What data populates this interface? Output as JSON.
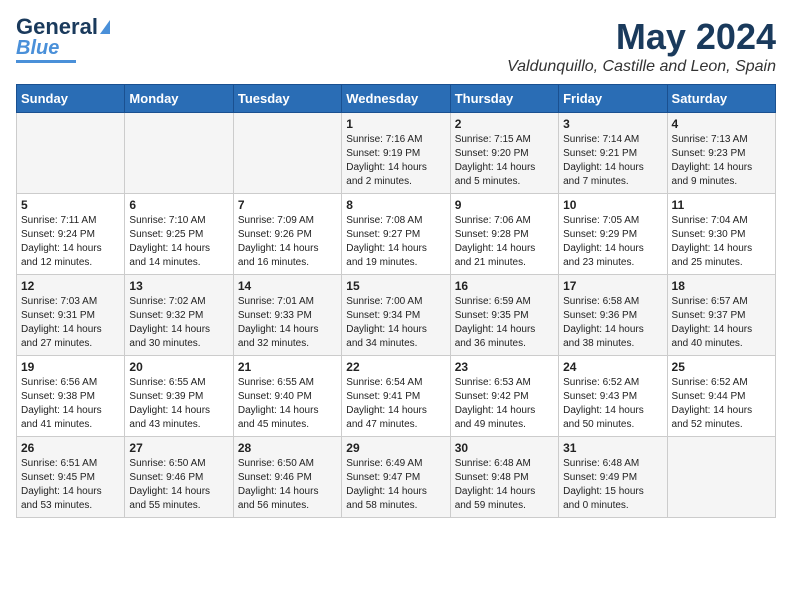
{
  "logo": {
    "line1": "General",
    "line2": "Blue"
  },
  "title": "May 2024",
  "location": "Valdunquillo, Castille and Leon, Spain",
  "headers": [
    "Sunday",
    "Monday",
    "Tuesday",
    "Wednesday",
    "Thursday",
    "Friday",
    "Saturday"
  ],
  "weeks": [
    [
      {
        "day": "",
        "info": ""
      },
      {
        "day": "",
        "info": ""
      },
      {
        "day": "",
        "info": ""
      },
      {
        "day": "1",
        "info": "Sunrise: 7:16 AM\nSunset: 9:19 PM\nDaylight: 14 hours\nand 2 minutes."
      },
      {
        "day": "2",
        "info": "Sunrise: 7:15 AM\nSunset: 9:20 PM\nDaylight: 14 hours\nand 5 minutes."
      },
      {
        "day": "3",
        "info": "Sunrise: 7:14 AM\nSunset: 9:21 PM\nDaylight: 14 hours\nand 7 minutes."
      },
      {
        "day": "4",
        "info": "Sunrise: 7:13 AM\nSunset: 9:23 PM\nDaylight: 14 hours\nand 9 minutes."
      }
    ],
    [
      {
        "day": "5",
        "info": "Sunrise: 7:11 AM\nSunset: 9:24 PM\nDaylight: 14 hours\nand 12 minutes."
      },
      {
        "day": "6",
        "info": "Sunrise: 7:10 AM\nSunset: 9:25 PM\nDaylight: 14 hours\nand 14 minutes."
      },
      {
        "day": "7",
        "info": "Sunrise: 7:09 AM\nSunset: 9:26 PM\nDaylight: 14 hours\nand 16 minutes."
      },
      {
        "day": "8",
        "info": "Sunrise: 7:08 AM\nSunset: 9:27 PM\nDaylight: 14 hours\nand 19 minutes."
      },
      {
        "day": "9",
        "info": "Sunrise: 7:06 AM\nSunset: 9:28 PM\nDaylight: 14 hours\nand 21 minutes."
      },
      {
        "day": "10",
        "info": "Sunrise: 7:05 AM\nSunset: 9:29 PM\nDaylight: 14 hours\nand 23 minutes."
      },
      {
        "day": "11",
        "info": "Sunrise: 7:04 AM\nSunset: 9:30 PM\nDaylight: 14 hours\nand 25 minutes."
      }
    ],
    [
      {
        "day": "12",
        "info": "Sunrise: 7:03 AM\nSunset: 9:31 PM\nDaylight: 14 hours\nand 27 minutes."
      },
      {
        "day": "13",
        "info": "Sunrise: 7:02 AM\nSunset: 9:32 PM\nDaylight: 14 hours\nand 30 minutes."
      },
      {
        "day": "14",
        "info": "Sunrise: 7:01 AM\nSunset: 9:33 PM\nDaylight: 14 hours\nand 32 minutes."
      },
      {
        "day": "15",
        "info": "Sunrise: 7:00 AM\nSunset: 9:34 PM\nDaylight: 14 hours\nand 34 minutes."
      },
      {
        "day": "16",
        "info": "Sunrise: 6:59 AM\nSunset: 9:35 PM\nDaylight: 14 hours\nand 36 minutes."
      },
      {
        "day": "17",
        "info": "Sunrise: 6:58 AM\nSunset: 9:36 PM\nDaylight: 14 hours\nand 38 minutes."
      },
      {
        "day": "18",
        "info": "Sunrise: 6:57 AM\nSunset: 9:37 PM\nDaylight: 14 hours\nand 40 minutes."
      }
    ],
    [
      {
        "day": "19",
        "info": "Sunrise: 6:56 AM\nSunset: 9:38 PM\nDaylight: 14 hours\nand 41 minutes."
      },
      {
        "day": "20",
        "info": "Sunrise: 6:55 AM\nSunset: 9:39 PM\nDaylight: 14 hours\nand 43 minutes."
      },
      {
        "day": "21",
        "info": "Sunrise: 6:55 AM\nSunset: 9:40 PM\nDaylight: 14 hours\nand 45 minutes."
      },
      {
        "day": "22",
        "info": "Sunrise: 6:54 AM\nSunset: 9:41 PM\nDaylight: 14 hours\nand 47 minutes."
      },
      {
        "day": "23",
        "info": "Sunrise: 6:53 AM\nSunset: 9:42 PM\nDaylight: 14 hours\nand 49 minutes."
      },
      {
        "day": "24",
        "info": "Sunrise: 6:52 AM\nSunset: 9:43 PM\nDaylight: 14 hours\nand 50 minutes."
      },
      {
        "day": "25",
        "info": "Sunrise: 6:52 AM\nSunset: 9:44 PM\nDaylight: 14 hours\nand 52 minutes."
      }
    ],
    [
      {
        "day": "26",
        "info": "Sunrise: 6:51 AM\nSunset: 9:45 PM\nDaylight: 14 hours\nand 53 minutes."
      },
      {
        "day": "27",
        "info": "Sunrise: 6:50 AM\nSunset: 9:46 PM\nDaylight: 14 hours\nand 55 minutes."
      },
      {
        "day": "28",
        "info": "Sunrise: 6:50 AM\nSunset: 9:46 PM\nDaylight: 14 hours\nand 56 minutes."
      },
      {
        "day": "29",
        "info": "Sunrise: 6:49 AM\nSunset: 9:47 PM\nDaylight: 14 hours\nand 58 minutes."
      },
      {
        "day": "30",
        "info": "Sunrise: 6:48 AM\nSunset: 9:48 PM\nDaylight: 14 hours\nand 59 minutes."
      },
      {
        "day": "31",
        "info": "Sunrise: 6:48 AM\nSunset: 9:49 PM\nDaylight: 15 hours\nand 0 minutes."
      },
      {
        "day": "",
        "info": ""
      }
    ]
  ]
}
